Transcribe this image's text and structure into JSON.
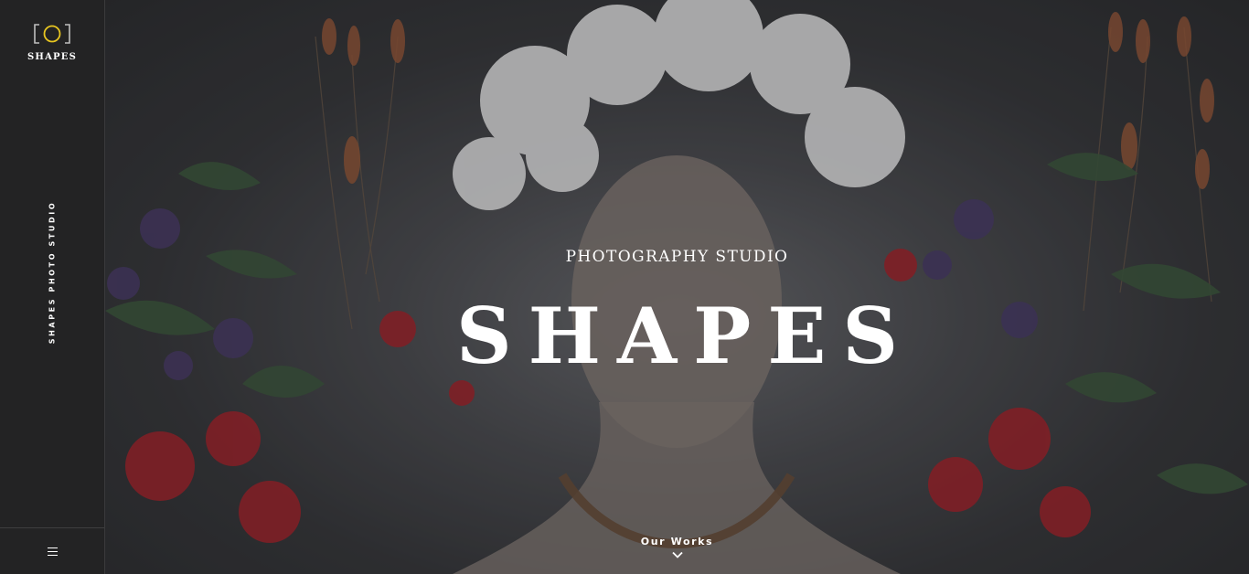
{
  "brand": {
    "name": "SHAPES",
    "tagline_vertical": "SHAPES PHOTO STUDIO",
    "accent_color": "#e8c620"
  },
  "sidebar": {
    "logo_icon": "camera-frame-icon",
    "menu_icon": "hamburger-menu-icon"
  },
  "hero": {
    "subtitle": "PHOTOGRAPHY STUDIO",
    "title": "SHAPES",
    "scroll_label": "Our Works",
    "scroll_icon": "chevron-down-icon",
    "background": "portrait-with-flower-crown-photo"
  }
}
